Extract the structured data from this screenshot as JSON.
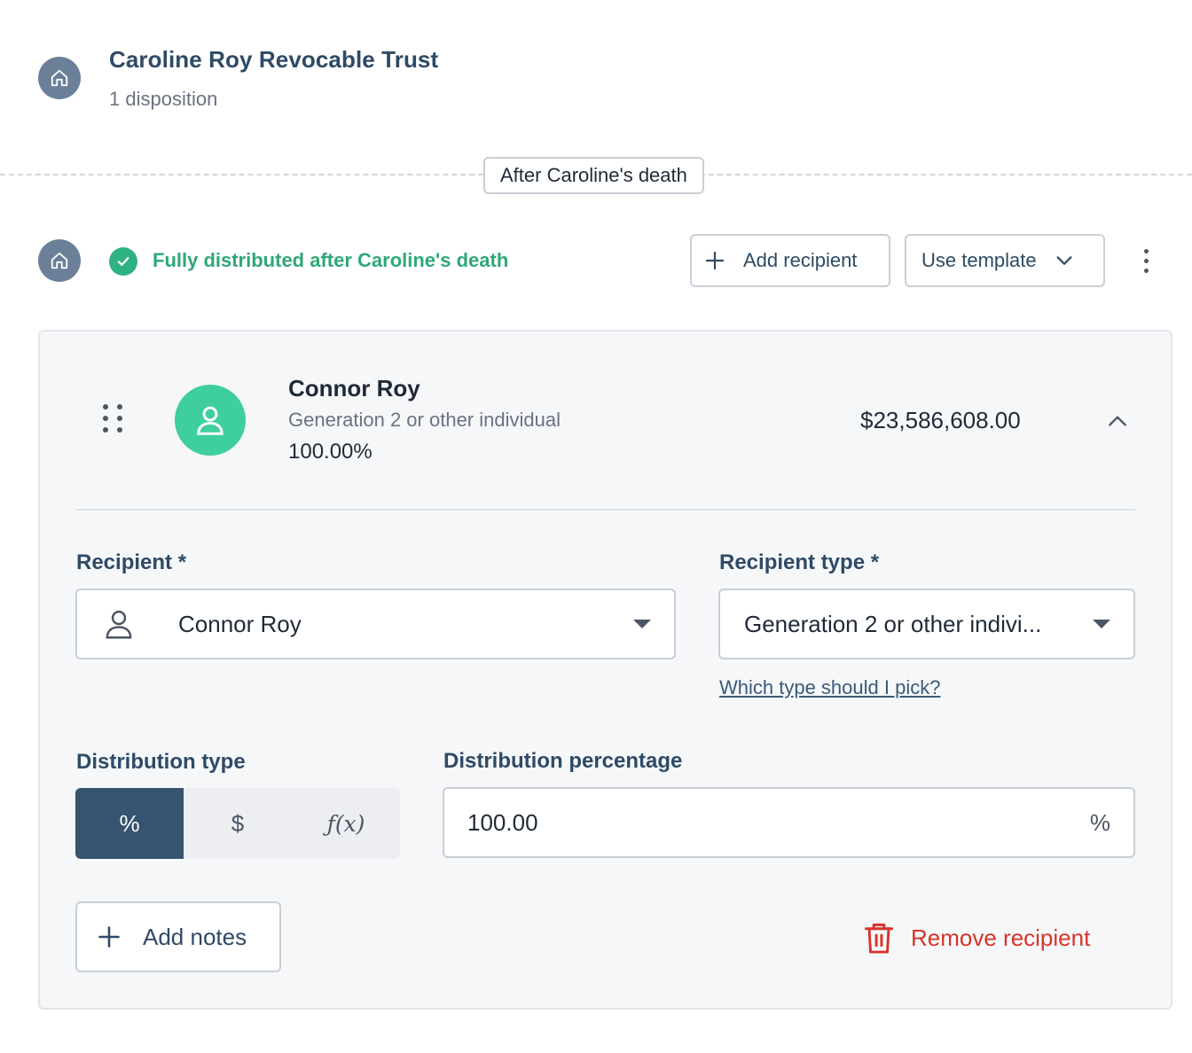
{
  "trust": {
    "title": "Caroline Roy Revocable Trust",
    "subtitle": "1 disposition"
  },
  "phase": {
    "label": "After Caroline's death"
  },
  "status": {
    "text": "Fully distributed after Caroline's death",
    "color": "#2fa877"
  },
  "toolbar": {
    "add_recipient_label": "Add recipient",
    "use_template_label": "Use template"
  },
  "recipient_card": {
    "name": "Connor Roy",
    "type": "Generation 2 or other individual",
    "percentage": "100.00%",
    "amount": "$23,586,608.00"
  },
  "form": {
    "recipient_label": "Recipient *",
    "recipient_value": "Connor Roy",
    "recipient_type_label": "Recipient type *",
    "recipient_type_value": "Generation 2 or other indivi...",
    "type_help_link": "Which type should I pick?",
    "distribution_type_label": "Distribution type",
    "distribution_type_options": [
      "%",
      "$",
      "ƒ(x)"
    ],
    "distribution_type_selected": "%",
    "distribution_percentage_label": "Distribution percentage",
    "distribution_percentage_value": "100.00",
    "distribution_percentage_unit": "%",
    "add_notes_label": "Add notes",
    "remove_recipient_label": "Remove recipient"
  },
  "colors": {
    "accent_navy": "#36536f",
    "success_green": "#2fb282",
    "avatar_green": "#3ecf9d",
    "danger_red": "#d6352a"
  },
  "icons": [
    "house-icon",
    "check-icon",
    "plus-icon",
    "chevron-down-icon",
    "kebab-menu-icon",
    "drag-handle-icon",
    "person-icon",
    "chevron-up-icon",
    "trash-icon"
  ]
}
